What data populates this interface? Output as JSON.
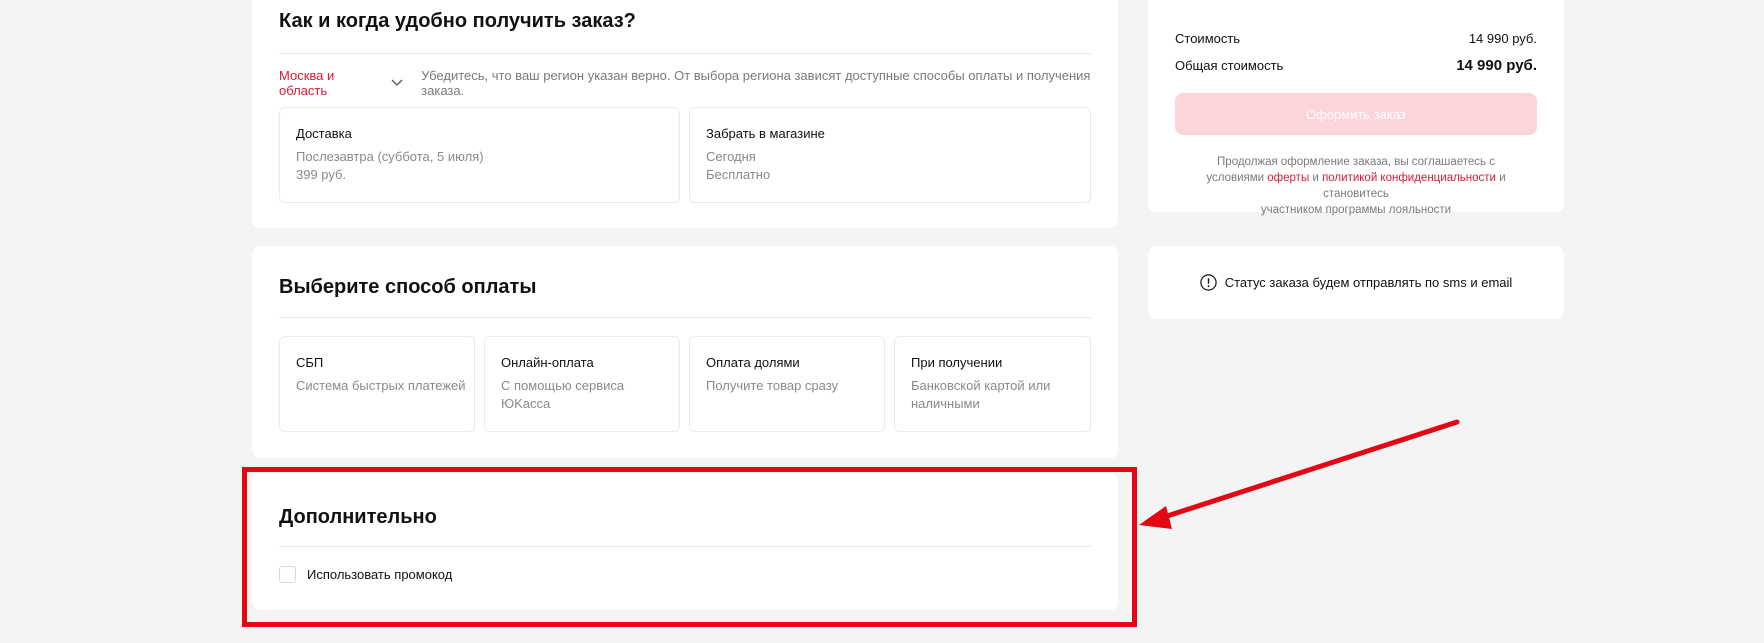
{
  "delivery": {
    "title": "Как и когда удобно получить заказ?",
    "region": "Москва и область",
    "region_hint": "Убедитесь, что ваш регион указан верно. От выбора региона зависят доступные способы оплаты и получения заказа.",
    "options": [
      {
        "title": "Доставка",
        "line1": "Послезавтра (суббота, 5 июля)",
        "line2": "399 руб."
      },
      {
        "title": "Забрать в магазине",
        "line1": "Сегодня",
        "line2": "Бесплатно"
      }
    ]
  },
  "payment": {
    "title": "Выберите способ оплаты",
    "options": [
      {
        "title": "СБП",
        "line1": "Система быстрых платежей",
        "line2": ""
      },
      {
        "title": "Онлайн-оплата",
        "line1": "С помощью сервиса ЮKасса",
        "line2": ""
      },
      {
        "title": "Оплата долями",
        "line1": "Получите товар сразу",
        "line2": ""
      },
      {
        "title": "При получении",
        "line1": "Банковской картой или",
        "line2": "наличными"
      }
    ]
  },
  "extra": {
    "title": "Дополнительно",
    "promo_label": "Использовать промокод",
    "promo_checked": false
  },
  "summary": {
    "cost_label": "Стоимость",
    "cost_value": "14 990 руб.",
    "total_label": "Общая стоимость",
    "total_value": "14 990 руб.",
    "order_button": "Оформить заказ",
    "legal_1": "Продолжая оформление заказа, вы соглашаетесь с",
    "legal_2": "условиями",
    "legal_offer": "оферты",
    "legal_and": "и",
    "legal_privacy": "политикой конфиденциальности",
    "legal_3": "и становитесь",
    "legal_4": "участником программы лояльности"
  },
  "status": {
    "text": "Статус заказа будем отправлять по sms и email",
    "icon": "info-icon"
  },
  "colors": {
    "accent": "#d81b37",
    "annotation": "#e30613",
    "button_disabled": "#fcd5da"
  }
}
